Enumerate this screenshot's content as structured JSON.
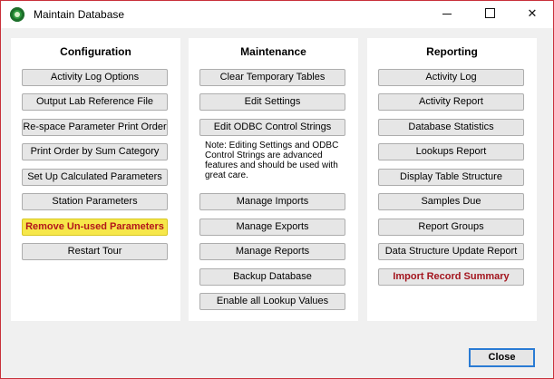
{
  "window": {
    "title": "Maintain Database",
    "controls": {
      "minimize": "minimize-icon",
      "maximize": "maximize-icon",
      "close": "close-icon"
    }
  },
  "configuration": {
    "title": "Configuration",
    "buttons": [
      "Activity Log Options",
      "Output Lab Reference File",
      "Re-space Parameter Print Order",
      "Print Order by Sum Category",
      "Set Up Calculated Parameters",
      "Station Parameters",
      "Remove Un-used Parameters",
      "Restart Tour"
    ]
  },
  "maintenance": {
    "title": "Maintenance",
    "buttons_top": [
      "Clear Temporary Tables",
      "Edit Settings",
      "Edit ODBC Control Strings"
    ],
    "note": "Note: Editing Settings and ODBC Control Strings are advanced features and should be used with great care.",
    "buttons_bottom": [
      "Manage Imports",
      "Manage Exports",
      "Manage Reports",
      "Backup Database",
      "Enable all Lookup Values"
    ]
  },
  "reporting": {
    "title": "Reporting",
    "buttons": [
      "Activity Log",
      "Activity Report",
      "Database Statistics",
      "Lookups Report",
      "Display Table Structure",
      "Samples Due",
      "Report Groups",
      "Data Structure Update Report",
      "Import Record Summary"
    ]
  },
  "footer": {
    "close_label": "Close"
  },
  "colors": {
    "highlight_bg": "#f6e74a",
    "highlight_text": "#b3151a",
    "red_text": "#a3151e",
    "window_border": "#c8303a"
  }
}
